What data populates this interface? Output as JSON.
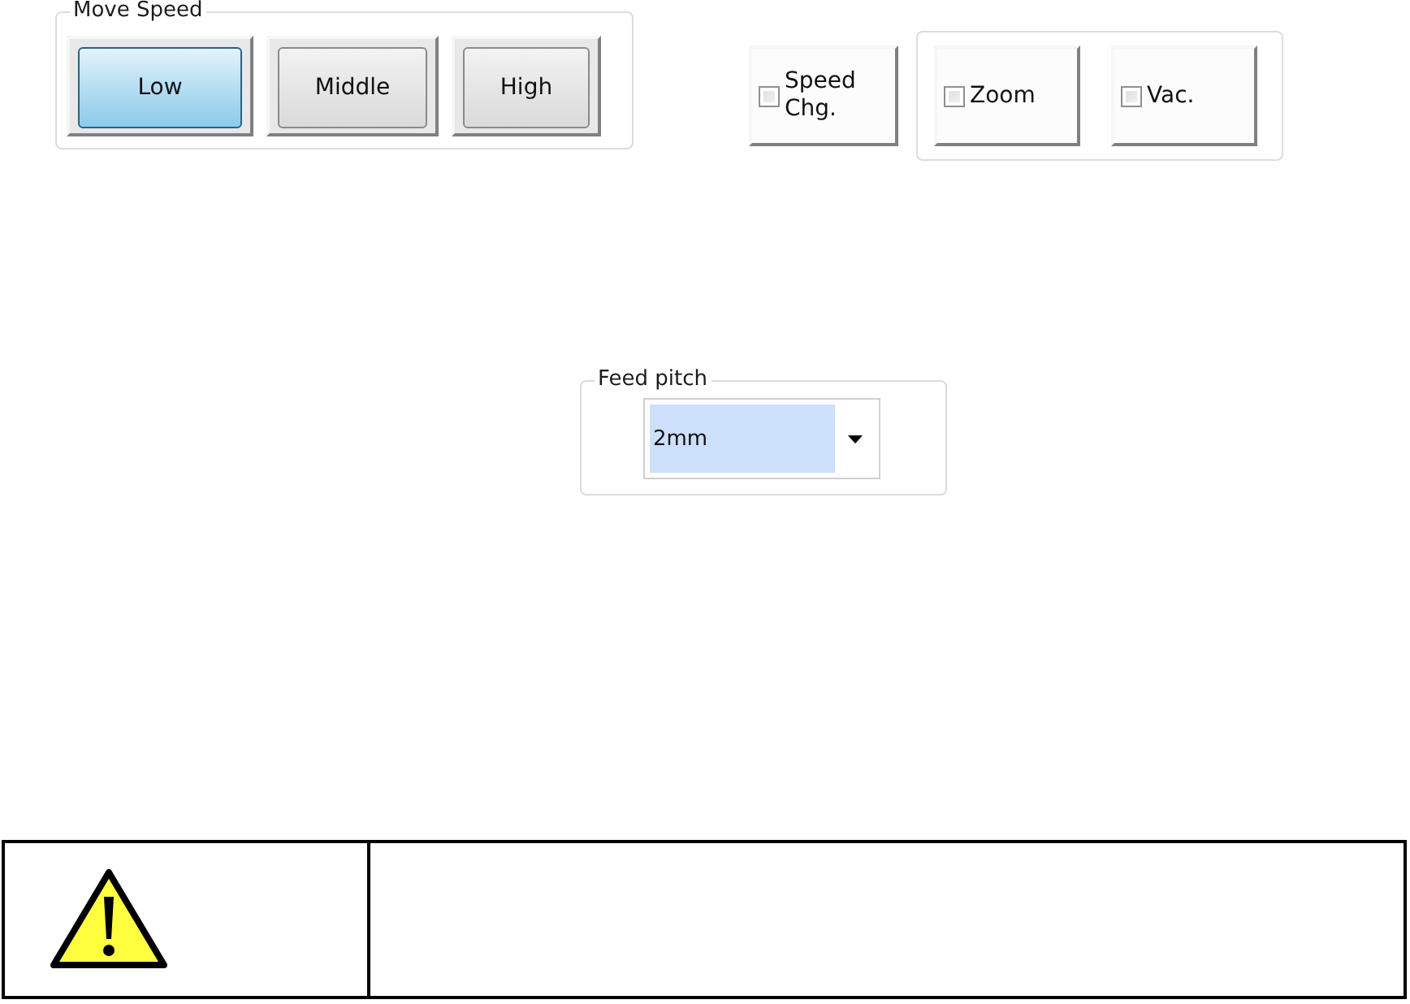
{
  "move_speed": {
    "title": "Move Speed",
    "buttons": [
      {
        "label": "Low",
        "selected": true
      },
      {
        "label": "Middle",
        "selected": false
      },
      {
        "label": "High",
        "selected": false
      }
    ]
  },
  "speed_change": {
    "label": "Speed Chg.",
    "checked": false
  },
  "toggles": [
    {
      "label": "Zoom",
      "checked": false
    },
    {
      "label": "Vac.",
      "checked": false
    }
  ],
  "feed_pitch": {
    "title": "Feed pitch",
    "value": "2mm"
  }
}
